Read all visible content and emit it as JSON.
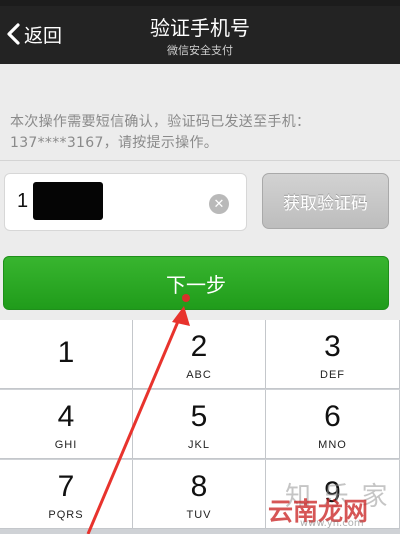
{
  "navbar": {
    "back_label": "返回",
    "title": "验证手机号",
    "subtitle": "微信安全支付"
  },
  "info_text": "本次操作需要短信确认，验证码已发送至手机：137****3167，请按提示操作。",
  "code_input": {
    "value": "1"
  },
  "get_code_label": "获取验证码",
  "next_label": "下一步",
  "keypad": [
    {
      "num": "1",
      "letters": ""
    },
    {
      "num": "2",
      "letters": "ABC"
    },
    {
      "num": "3",
      "letters": "DEF"
    },
    {
      "num": "4",
      "letters": "GHI"
    },
    {
      "num": "5",
      "letters": "JKL"
    },
    {
      "num": "6",
      "letters": "MNO"
    },
    {
      "num": "7",
      "letters": "PQRS"
    },
    {
      "num": "8",
      "letters": "TUV"
    },
    {
      "num": "9",
      "letters": ""
    }
  ],
  "watermark": {
    "text1": "知 乐 家",
    "text2": "云南龙网",
    "text3": "www.yn.com"
  },
  "colors": {
    "navbar": "#232323",
    "accent_green": "#2aa824",
    "arrow_red": "#e8332d",
    "button_gray": "#c6c6c6"
  }
}
